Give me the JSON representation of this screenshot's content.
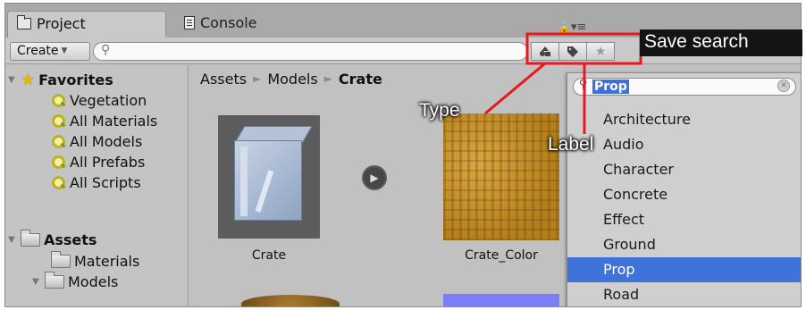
{
  "tabs": [
    {
      "label": "Project",
      "icon": "folder-icon"
    },
    {
      "label": "Console",
      "icon": "console-icon"
    }
  ],
  "toolbar": {
    "create_label": "Create",
    "search_placeholder": "",
    "filter_buttons": [
      "type-filter-icon",
      "label-filter-icon",
      "star-icon"
    ]
  },
  "sidebar": {
    "favorites_label": "Favorites",
    "favorites": [
      "Vegetation",
      "All Materials",
      "All Models",
      "All Prefabs",
      "All Scripts"
    ],
    "assets_label": "Assets",
    "assets": [
      "Materials",
      "Models"
    ]
  },
  "breadcrumb": [
    "Assets",
    "Models",
    "Crate"
  ],
  "assets_grid": {
    "items": [
      "Crate",
      "Crate_Color"
    ]
  },
  "label_dropdown": {
    "query": "Prop",
    "items": [
      "Architecture",
      "Audio",
      "Character",
      "Concrete",
      "Effect",
      "Ground",
      "Prop",
      "Road"
    ],
    "selected": "Prop",
    "selected_color": "#3f73d9"
  },
  "callouts": {
    "save_search": "Save search",
    "type": "Type",
    "label": "Label",
    "line_color": "#e8181e"
  }
}
